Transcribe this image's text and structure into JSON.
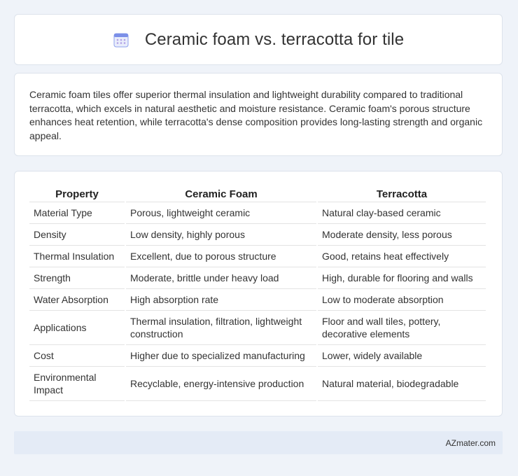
{
  "header": {
    "title": "Ceramic foam vs. terracotta for tile",
    "icon": "calendar-icon",
    "icon_color": "#7b8fe8"
  },
  "intro": {
    "text": "Ceramic foam tiles offer superior thermal insulation and lightweight durability compared to traditional terracotta, which excels in natural aesthetic and moisture resistance. Ceramic foam's porous structure enhances heat retention, while terracotta's dense composition provides long-lasting strength and organic appeal."
  },
  "table": {
    "headers": [
      "Property",
      "Ceramic Foam",
      "Terracotta"
    ],
    "rows": [
      [
        "Material Type",
        "Porous, lightweight ceramic",
        "Natural clay-based ceramic"
      ],
      [
        "Density",
        "Low density, highly porous",
        "Moderate density, less porous"
      ],
      [
        "Thermal Insulation",
        "Excellent, due to porous structure",
        "Good, retains heat effectively"
      ],
      [
        "Strength",
        "Moderate, brittle under heavy load",
        "High, durable for flooring and walls"
      ],
      [
        "Water Absorption",
        "High absorption rate",
        "Low to moderate absorption"
      ],
      [
        "Applications",
        "Thermal insulation, filtration, lightweight construction",
        "Floor and wall tiles, pottery, decorative elements"
      ],
      [
        "Cost",
        "Higher due to specialized manufacturing",
        "Lower, widely available"
      ],
      [
        "Environmental Impact",
        "Recyclable, energy-intensive production",
        "Natural material, biodegradable"
      ]
    ]
  },
  "footer": {
    "brand": "AZmater.com"
  }
}
